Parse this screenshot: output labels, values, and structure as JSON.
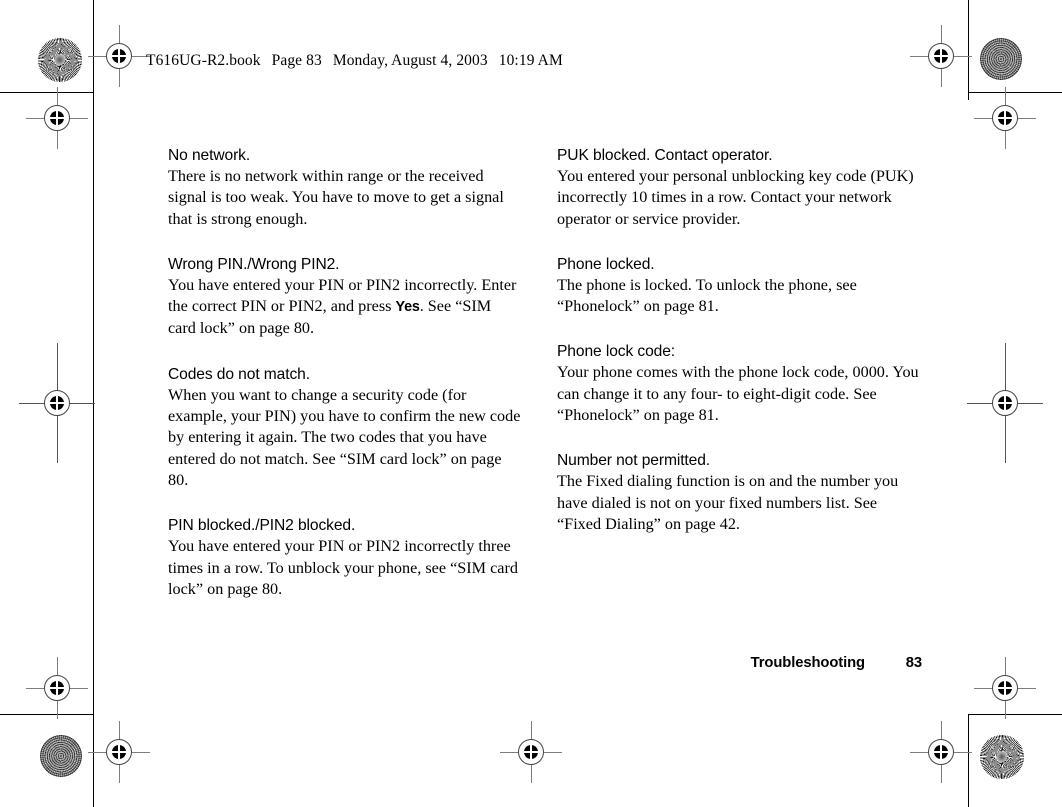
{
  "header": {
    "filename": "T616UG-R2.book",
    "page_label": "Page 83",
    "weekday": "Monday, August 4, 2003",
    "time": "10:19 AM"
  },
  "footer": {
    "chapter": "Troubleshooting",
    "page_number": "83"
  },
  "columns": {
    "left": [
      {
        "heading": "No network.",
        "body": "There is no network within range or the received signal is too weak. You have to move to get a signal that is strong enough."
      },
      {
        "heading": "Wrong PIN./Wrong PIN2.",
        "body_pre": "You have entered your PIN or PIN2 incorrectly. Enter the correct PIN or PIN2, and press ",
        "body_key": "Yes",
        "body_post": ". See “SIM card lock” on page 80."
      },
      {
        "heading": "Codes do not match.",
        "body": "When you want to change a security code (for example, your PIN) you have to confirm the new code by entering it again. The two codes that you have entered do not match. See “SIM card lock” on page 80."
      },
      {
        "heading": "PIN blocked./PIN2 blocked.",
        "body": "You have entered your PIN or PIN2 incorrectly three times in a row. To unblock your phone, see “SIM card lock” on page 80."
      }
    ],
    "right": [
      {
        "heading": "PUK blocked. Contact operator.",
        "body": "You entered your personal unblocking key code (PUK) incorrectly 10 times in a row. Contact your network operator or service provider."
      },
      {
        "heading": "Phone locked.",
        "body": "The phone is locked. To unlock the phone, see “Phonelock” on page 81."
      },
      {
        "heading": "Phone lock code:",
        "body": "Your phone comes with the phone lock code, 0000. You can change it to any four- to eight-digit code. See “Phonelock” on page 81."
      },
      {
        "heading": "Number not permitted.",
        "body": "The Fixed dialing function is on and the number you have dialed is not on your fixed numbers list. See “Fixed Dialing” on page 42."
      }
    ]
  },
  "colors": {
    "page_background": "#ffffff",
    "text": "#000000",
    "crop_rule": "#000000",
    "registration_line": "#7d7d7d"
  }
}
